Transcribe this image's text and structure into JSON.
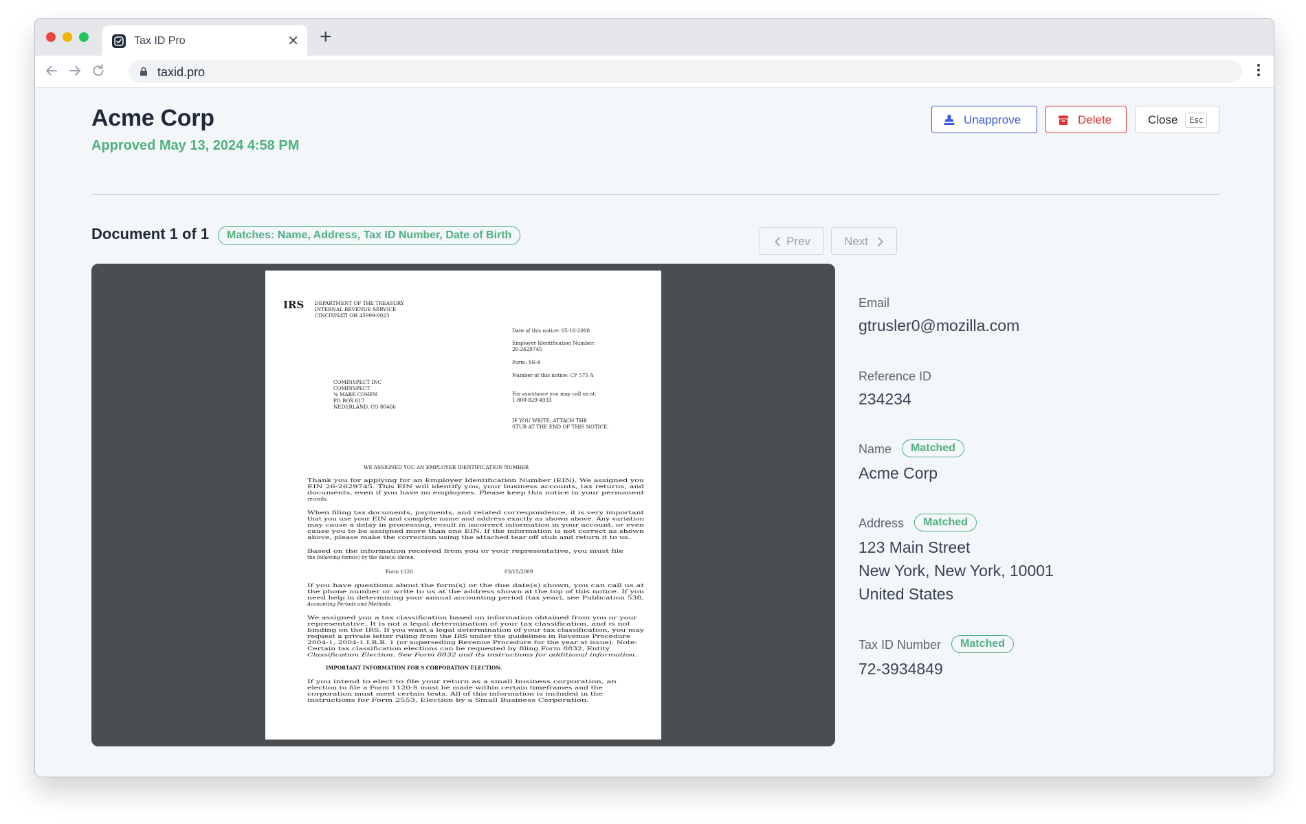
{
  "browser": {
    "tab_title": "Tax ID Pro",
    "tab_close_glyph": "✕",
    "new_tab_glyph": "+",
    "url": "taxid.pro"
  },
  "header": {
    "title": "Acme Corp",
    "status": "Approved May 13, 2024 4:58 PM",
    "status_color": "#4fb07f"
  },
  "actions": {
    "unapprove_label": "Unapprove",
    "delete_label": "Delete",
    "close_label": "Close",
    "close_shortcut": "Esc"
  },
  "document": {
    "label": "Document 1 of 1",
    "matches": "Matches: Name, Address, Tax ID Number, Date of Birth",
    "prev_label": "Prev",
    "next_label": "Next"
  },
  "irs_letter": {
    "logo": "IRS",
    "dept_line1": "DEPARTMENT OF THE TREASURY",
    "dept_line2": "INTERNAL REVENUE SERVICE",
    "dept_line3": "CINCINNATI  OH   45999-0023",
    "notice_date": "Date of this notice:  05-16-2008",
    "ein_label": "Employer Identification Number:",
    "ein_value": "26-2629745",
    "form": "Form:  SS-4",
    "notice_number": "Number of this notice:  CP 575 A",
    "assistance_line1": "For assistance you may call us at:",
    "assistance_line2": "1-800-829-4933",
    "write_line1": "IF YOU WRITE, ATTACH THE",
    "write_line2": "STUB AT THE END OF THIS NOTICE.",
    "addr_line1": "COMINSPECT INC",
    "addr_line2": "COMINSPECT",
    "addr_line3": "% MARK COHEN",
    "addr_line4": "PO BOX 617",
    "addr_line5": "NEDERLAND, CO  80466",
    "heading": "WE ASSIGNED YOU AN EMPLOYER IDENTIFICATION NUMBER",
    "p1_l1": "     Thank you for applying for an Employer Identification Number (EIN).  We assigned you",
    "p1_l2": "EIN 26-2629745.  This EIN will identify you, your business accounts, tax returns, and",
    "p1_l3": "documents, even if you have no employees.  Please keep this notice in your permanent",
    "p1_l4": "records.",
    "p2_l1": "     When filing tax documents, payments, and related correspondence, it is very important",
    "p2_l2": "that you use your EIN and complete name and address exactly as shown above.  Any variation",
    "p2_l3": "may cause a delay in processing, result in incorrect information in your account, or even",
    "p2_l4": "cause you to be assigned more than one EIN.  If the information is not correct as shown",
    "p2_l5": "above, please make the correction using the attached tear off stub and return it to us.",
    "p3_l1": "     Based on the information received from you or your representative, you must file",
    "p3_l2": "the following form(s) by the date(s) shown.",
    "form_row_name": "Form 1120",
    "form_row_date": "03/15/2009",
    "p4_l1": "     If you have questions about the form(s) or the due date(s) shown, you can call us at",
    "p4_l2": "the phone number or write to us at the address shown at the top of this notice.  If you",
    "p4_l3": "need help in determining your annual accounting period (tax year), see Publication 538,",
    "p4_l4": "Accounting Periods and Methods.",
    "p5_l1": "     We assigned you a tax classification based on information obtained from you or your",
    "p5_l2": "representative.  It is not a legal determination of your tax classification, and is not",
    "p5_l3": "binding on the IRS.  If you want a legal determination of your tax classification, you may",
    "p5_l4": "request a private letter ruling from the IRS under the guidelines in Revenue Procedure",
    "p5_l5": "2004-1, 2004-1 I.R.B. 1 (or superseding Revenue Procedure for the year at issue).  Note:",
    "p5_l6": "Certain tax classification elections can be requested by filing Form 8832, Entity",
    "p5_l7": "Classification Election.  See Form 8832 and its instructions for additional information.",
    "s_corp_heading": "IMPORTANT INFORMATION FOR S CORPORATION ELECTION:",
    "p6_l1": "     If you intend to elect to file your return as a small business corporation, an",
    "p6_l2": "election to file a Form 1120-S must be made within certain timeframes and the",
    "p6_l3": "corporation must meet certain tests.  All of this information is included in the",
    "p6_l4": "instructions for Form 2553, Election by a Small Business Corporation."
  },
  "details": {
    "email_label": "Email",
    "email_value": "gtrusler0@mozilla.com",
    "reference_label": "Reference ID",
    "reference_value": "234234",
    "name_label": "Name",
    "name_badge": "Matched",
    "name_value": "Acme Corp",
    "address_label": "Address",
    "address_badge": "Matched",
    "address_line1": "123 Main Street",
    "address_line2": "New York, New York, 10001",
    "address_line3": "United States",
    "taxid_label": "Tax ID Number",
    "taxid_badge": "Matched",
    "taxid_value": "72-3934849"
  },
  "colors": {
    "accent_blue": "#3b5bdb",
    "danger_red": "#e03131",
    "success_green": "#4fb07f",
    "viewer_bg": "#4a4e50"
  }
}
